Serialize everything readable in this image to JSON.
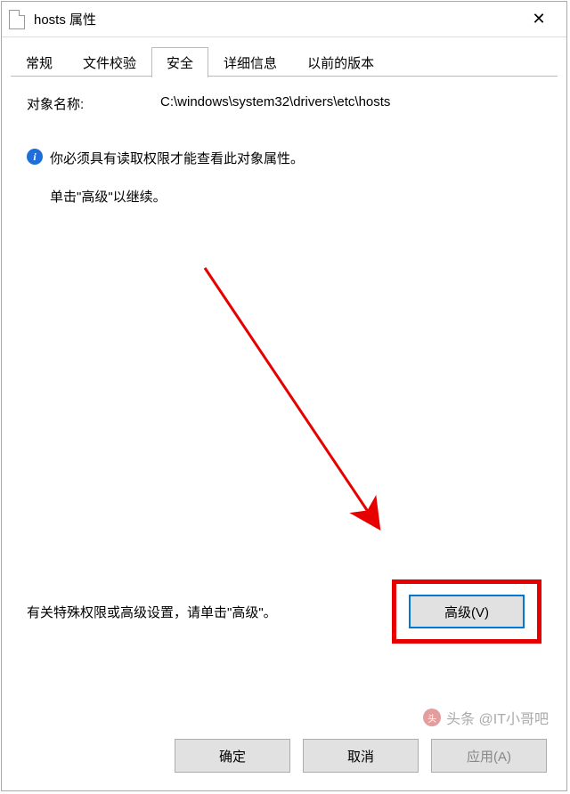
{
  "title": "hosts 属性",
  "tabs": [
    {
      "label": "常规"
    },
    {
      "label": "文件校验"
    },
    {
      "label": "安全"
    },
    {
      "label": "详细信息"
    },
    {
      "label": "以前的版本"
    }
  ],
  "active_tab": 2,
  "object_name_label": "对象名称:",
  "object_name_value": "C:\\windows\\system32\\drivers\\etc\\hosts",
  "info_message": "你必须具有读取权限才能查看此对象属性。",
  "continue_message": "单击\"高级\"以继续。",
  "perm_hint": "有关特殊权限或高级设置，请单击\"高级\"。",
  "advanced_button": "高级(V)",
  "ok_button": "确定",
  "cancel_button": "取消",
  "apply_button": "应用(A)",
  "watermark": "头条 @IT小哥吧"
}
